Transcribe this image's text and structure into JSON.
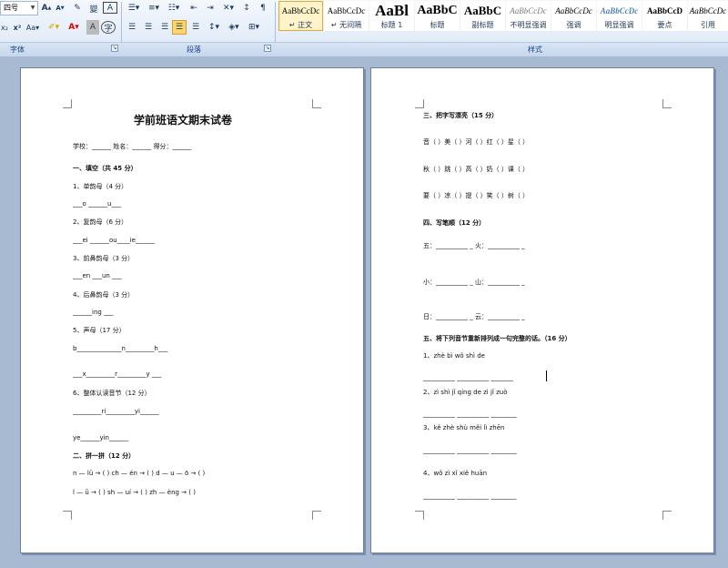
{
  "ribbon": {
    "font_size": "四号",
    "font_group_label": "字体",
    "paragraph_group_label": "段落",
    "styles_group_label": "样式",
    "styles": [
      {
        "sample": "AaBbCcDc",
        "name": "↵ 正文"
      },
      {
        "sample": "AaBbCcDc",
        "name": "↵ 无间隔"
      },
      {
        "sample": "AaBl",
        "name": "标题 1"
      },
      {
        "sample": "AaBbC",
        "name": "标题"
      },
      {
        "sample": "AaBbC",
        "name": "副标题"
      },
      {
        "sample": "AaBbCcDc",
        "name": "不明显强调"
      },
      {
        "sample": "AaBbCcDc",
        "name": "强调"
      },
      {
        "sample": "AaBbCcDc",
        "name": "明显强调"
      },
      {
        "sample": "AaBbCcD",
        "name": "要点"
      },
      {
        "sample": "AaBbCcDc",
        "name": "引用"
      }
    ]
  },
  "page1": {
    "title": "学前班语文期末试卷",
    "header_line": "学校：______      姓名：______      得分：______",
    "lines": [
      "一、填空（共 45 分）",
      "1、单韵母（4 分）",
      "___o ______u___",
      "2、复韵母（6 分）",
      "___ei ______ou____ie______",
      "3、前鼻韵母（3 分）",
      "___en ___un ___",
      "4、后鼻韵母（3 分）",
      "______ing ___",
      "5、声母（17 分）",
      "b______________n_________h___",
      "___x_________r_________y ___",
      "6、整体认读音节（12 分）",
      "_________ri_________yi______",
      "ye______yin______",
      "二、拼一拼（12 分）",
      "n — lü → (        )        ch — én → (        )        d — u — ō → (        )",
      "l — ǜ → (        )        sh — uí → (        )        zh — èng → (        )"
    ]
  },
  "page2": {
    "lines": [
      "三、把字写漂亮（15 分）",
      "音（     ）美（     ）河（     ）红（     ）星（     ）",
      "秋（     ）跳（     ）高（     ）奶（     ）课（     ）",
      "要（     ）凉（     ）提（     ）笑（     ）树（     ）",
      "四、写笔顺（12 分）",
      "五：__________ _                        火：__________ _",
      "小：__________ _                        山：__________ _",
      "日：__________ _                        云：__________ _",
      "五、将下列音节重新排列成一句完整的话。（16 分）",
      "1、zhè   bì   wǒ   shì   de",
      "__________  __________  _______",
      "2、zì   shì   jǐ   qíng   de   zì   jǐ   zuò",
      "__________  __________  ________",
      "3、kě   zhè   shù   měi   lì   zhēn",
      "__________  __________  ________",
      "4、wǒ   zì   xǐ   xiě   huān",
      "__________  __________  ________"
    ]
  }
}
